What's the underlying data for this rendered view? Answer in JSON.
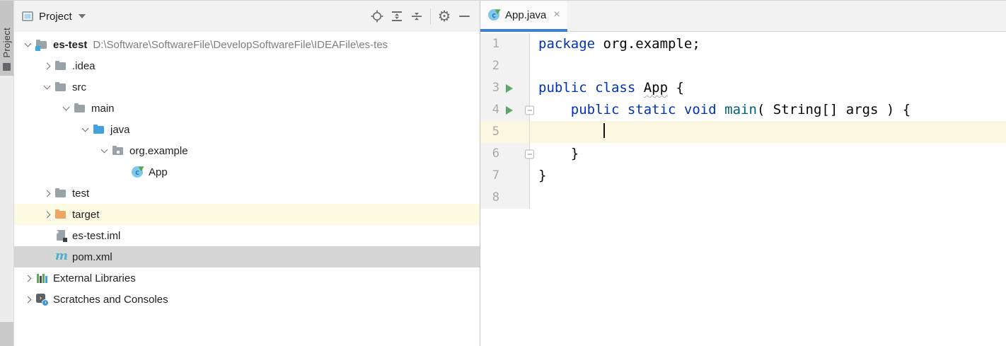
{
  "stripe": {
    "active_tool_label": "Project"
  },
  "panel": {
    "header": {
      "title": "Project",
      "icons": [
        "select-opened-file",
        "expand-all",
        "collapse-all",
        "settings",
        "hide"
      ]
    },
    "tree": [
      {
        "label": "es-test",
        "path": "D:\\Software\\SoftwareFile\\DevelopSoftwareFile\\IDEAFile\\es-tes",
        "icon": "project-root-folder",
        "state": "expanded",
        "level": 0
      },
      {
        "label": ".idea",
        "icon": "folder",
        "state": "collapsed",
        "level": 1
      },
      {
        "label": "src",
        "icon": "folder",
        "state": "expanded",
        "level": 1
      },
      {
        "label": "main",
        "icon": "folder",
        "state": "expanded",
        "level": 2
      },
      {
        "label": "java",
        "icon": "sources-folder",
        "state": "expanded",
        "level": 3
      },
      {
        "label": "org.example",
        "icon": "package-folder",
        "state": "expanded",
        "level": 4
      },
      {
        "label": "App",
        "icon": "java-class",
        "state": "leaf",
        "level": 5
      },
      {
        "label": "test",
        "icon": "folder",
        "state": "collapsed",
        "level": 1
      },
      {
        "label": "target",
        "icon": "excluded-folder",
        "state": "collapsed",
        "level": 1,
        "highlight": "excluded-yellow"
      },
      {
        "label": "es-test.iml",
        "icon": "iml-file",
        "state": "leaf",
        "level": 1
      },
      {
        "label": "pom.xml",
        "icon": "maven-file",
        "state": "leaf",
        "level": 1,
        "highlight": "selected"
      },
      {
        "label": "External Libraries",
        "icon": "libraries",
        "state": "collapsed",
        "level": 0
      },
      {
        "label": "Scratches and Consoles",
        "icon": "scratches-consoles",
        "state": "collapsed",
        "level": 0
      }
    ]
  },
  "editor": {
    "tab": {
      "title": "App.java",
      "close_glyph": "×"
    },
    "glyphs": {
      "class_letter": "c",
      "maven_letter": "m",
      "scratch_chevron": "›",
      "gear": "⚙"
    },
    "lines": [
      {
        "num": "1",
        "tokens": [
          {
            "text": "package",
            "type": "keyword"
          },
          {
            "text": " org.example;",
            "type": "plain"
          }
        ]
      },
      {
        "num": "2",
        "tokens": []
      },
      {
        "num": "3",
        "tokens": [
          {
            "text": "public class",
            "type": "keyword"
          },
          {
            "text": " ",
            "type": "plain"
          },
          {
            "text": "App",
            "type": "typo"
          },
          {
            "text": " {",
            "type": "plain"
          }
        ]
      },
      {
        "num": "4",
        "tokens": [
          {
            "text": "    ",
            "type": "plain"
          },
          {
            "text": "public static void",
            "type": "keyword"
          },
          {
            "text": " ",
            "type": "plain"
          },
          {
            "text": "main",
            "type": "method"
          },
          {
            "text": "( String[] args ) {",
            "type": "plain"
          }
        ]
      },
      {
        "num": "5",
        "tokens": [
          {
            "text": "        ",
            "type": "plain"
          }
        ],
        "caret": true
      },
      {
        "num": "6",
        "tokens": [
          {
            "text": "    }",
            "type": "plain"
          }
        ]
      },
      {
        "num": "7",
        "tokens": [
          {
            "text": "}",
            "type": "plain"
          }
        ]
      },
      {
        "num": "8",
        "tokens": []
      }
    ]
  },
  "colors": {
    "keyword": "#0033B3",
    "method_declaration": "#00627A",
    "tab_underline": "#3D80DC",
    "caret_row": "#FBF6E0",
    "selected_row": "#D5D5D5",
    "excluded_row": "#FDFBE3",
    "run_gutter_green": "#59A869",
    "sources_folder_blue": "#45A1DC",
    "excluded_folder_orange": "#ECA562",
    "maven_cyan": "#4FAECB"
  }
}
